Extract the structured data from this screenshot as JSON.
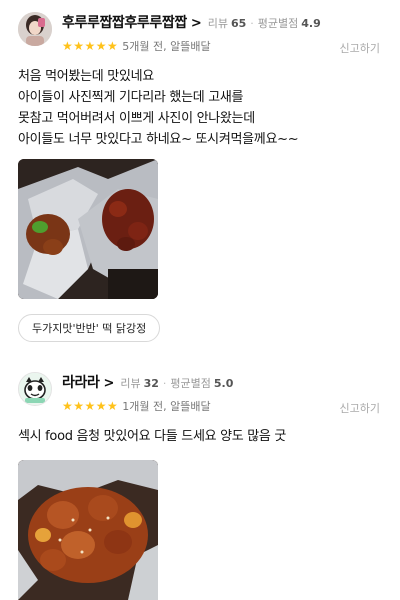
{
  "reviews": [
    {
      "nickname": "후루루짭짭후루루짭짭",
      "review_label": "리뷰",
      "review_count": "65",
      "avg_label": "평균별점",
      "avg_rating": "4.9",
      "stars": "★★★★★",
      "when": "5개월 전, 알뜰배달",
      "report": "신고하기",
      "text_lines": [
        "처음 먹어봤는데 맛있네요",
        "아이들이 사진찍게 기다리라 했는데 고새를",
        "못참고 먹어버려서 이쁘게 사진이 안나왔는데",
        "아이들도 너무 맛있다고 하네요~ 또시켜먹을께요~~"
      ],
      "menu_tag": "두가지맛'반반' 떡 닭강정"
    },
    {
      "nickname": "라라라",
      "review_label": "리뷰",
      "review_count": "32",
      "avg_label": "평균별점",
      "avg_rating": "5.0",
      "stars": "★★★★★",
      "when": "1개월 전, 알뜰배달",
      "report": "신고하기",
      "text_lines": [
        "섹시 food 음청 맛있어요 다들 드세요 양도 많음 굿"
      ]
    }
  ],
  "colors": {
    "star": "#ffc21a",
    "muted_text": "#999999",
    "chip_border": "#d9d9d9"
  }
}
